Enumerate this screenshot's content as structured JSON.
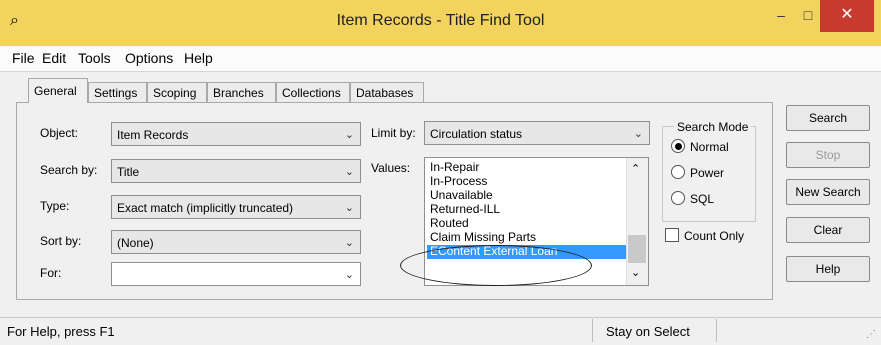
{
  "window": {
    "title": "Item Records - Title Find Tool",
    "minimize": "–",
    "maximize": "□",
    "close": "✕",
    "icon": "app-icon"
  },
  "menu": [
    "File",
    "Edit",
    "Tools",
    "Options",
    "Help"
  ],
  "tabs": [
    "General",
    "Settings",
    "Scoping",
    "Branches",
    "Collections",
    "Databases"
  ],
  "form": {
    "object_label": "Object:",
    "object_value": "Item Records",
    "search_by_label": "Search by:",
    "search_by_value": "Title",
    "type_label": "Type:",
    "type_value": "Exact match (implicitly truncated)",
    "sort_by_label": "Sort by:",
    "sort_by_value": "(None)",
    "for_label": "For:",
    "for_value": "",
    "limit_by_label": "Limit by:",
    "limit_by_value": "Circulation status",
    "values_label": "Values:"
  },
  "values_list": [
    "In-Repair",
    "In-Process",
    "Unavailable",
    "Returned-ILL",
    "Routed",
    "Claim Missing Parts",
    "EContent External Loan"
  ],
  "selected_value": "EContent External Loan",
  "search_mode": {
    "title": "Search Mode",
    "options": [
      "Normal",
      "Power",
      "SQL"
    ],
    "selected": "Normal"
  },
  "count_only": {
    "label": "Count Only",
    "checked": false
  },
  "buttons": {
    "search": "Search",
    "stop": "Stop",
    "new_search": "New Search",
    "clear": "Clear",
    "help": "Help"
  },
  "status": {
    "help": "For Help, press F1",
    "stay": "Stay on Select"
  },
  "colors": {
    "titlebar": "#f1d35e",
    "close": "#c8392f",
    "selection": "#3399ff"
  }
}
